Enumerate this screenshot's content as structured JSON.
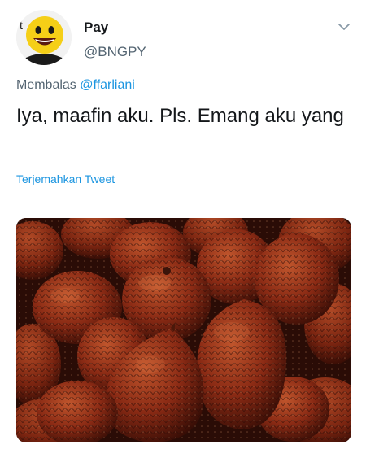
{
  "author": {
    "display_name": "Pay",
    "handle": "@BNGPY"
  },
  "reply": {
    "prefix": "Membalas",
    "mention": "@ffarliani"
  },
  "tweet": {
    "text": "Iya, maafin aku. Pls. Emang aku yang"
  },
  "translate_link": "Terjemahkan Tweet",
  "icons": {
    "menu": "chevron-down-icon",
    "avatar": "smiley-face-avatar"
  },
  "colors": {
    "link": "#1b95e0",
    "secondary_text": "#536471",
    "primary_text": "#14171a"
  }
}
